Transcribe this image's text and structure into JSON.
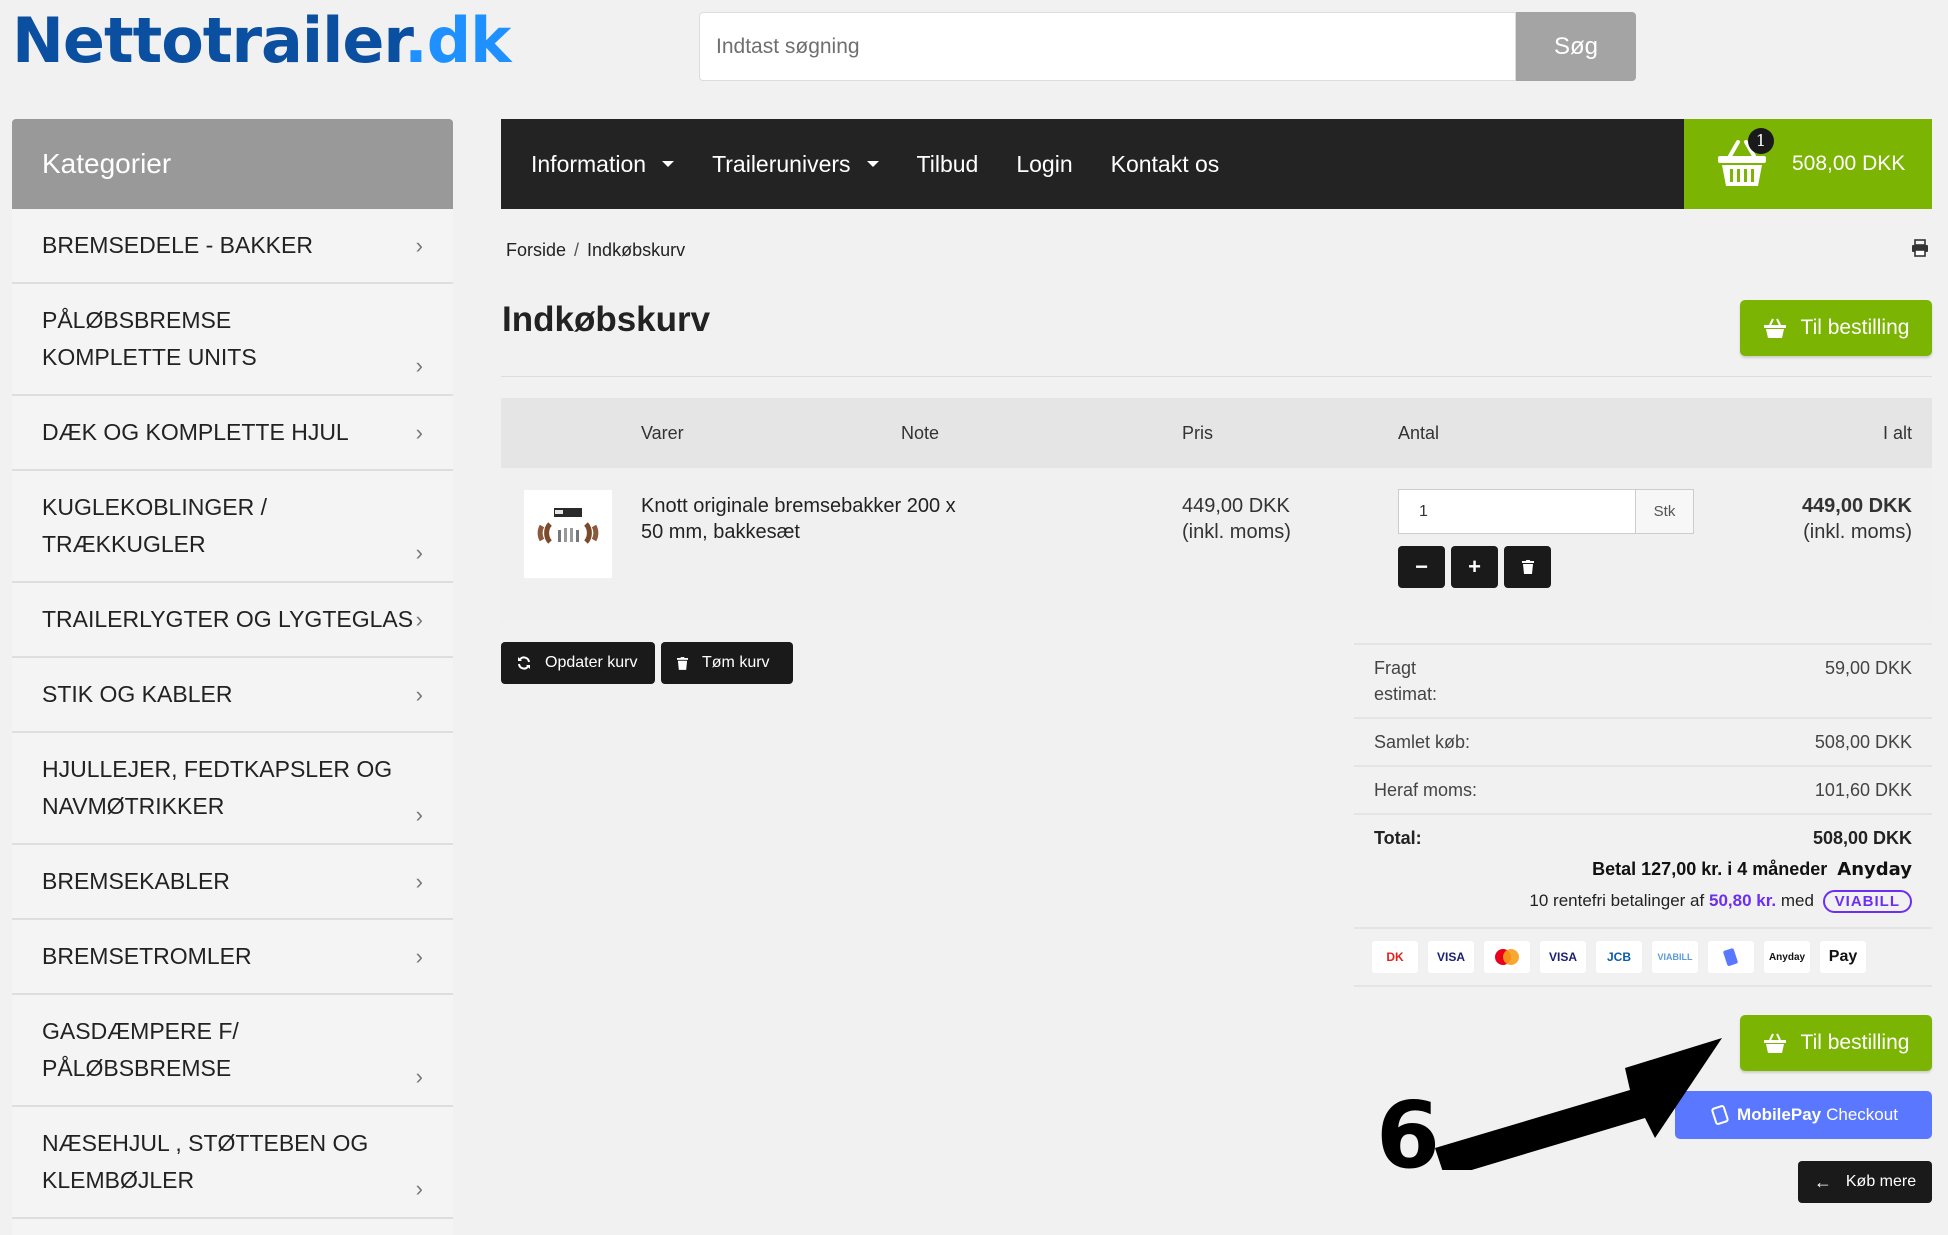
{
  "logo": {
    "main": "Nettotrailer",
    "tld": ".dk"
  },
  "search": {
    "placeholder": "Indtast søgning",
    "button": "Søg"
  },
  "sidebar": {
    "title": "Kategorier",
    "items": [
      {
        "label": "BREMSEDELE - BAKKER"
      },
      {
        "label": "PÅLØBSBREMSE KOMPLETTE UNITS"
      },
      {
        "label": "DÆK OG KOMPLETTE HJUL"
      },
      {
        "label": "KUGLEKOBLINGER / TRÆKKUGLER"
      },
      {
        "label": "TRAILERLYGTER OG LYGTEGLAS"
      },
      {
        "label": "STIK OG KABLER"
      },
      {
        "label": "HJULLEJER, FEDTKAPSLER OG NAVMØTRIKKER"
      },
      {
        "label": "BREMSEKABLER"
      },
      {
        "label": "BREMSETROMLER"
      },
      {
        "label": "GASDÆMPERE F/ PÅLØBSBREMSE"
      },
      {
        "label": "NÆSEHJUL , STØTTEBEN OG KLEMBØJLER"
      }
    ]
  },
  "nav": {
    "items": [
      {
        "label": "Information"
      },
      {
        "label": "Trailerunivers"
      },
      {
        "label": "Tilbud"
      },
      {
        "label": "Login"
      },
      {
        "label": "Kontakt os"
      }
    ]
  },
  "cart_widget": {
    "count": "1",
    "total": "508,00 DKK"
  },
  "breadcrumb": {
    "home": "Forside",
    "sep": "/",
    "current": "Indkøbskurv"
  },
  "page": {
    "title": "Indkøbskurv",
    "checkout_label": "Til bestilling"
  },
  "table": {
    "headers": {
      "items": "Varer",
      "note": "Note",
      "price": "Pris",
      "qty": "Antal",
      "total": "I alt"
    },
    "rows": [
      {
        "name": "Knott originale bremsebakker 200 x 50 mm, bakkesæt",
        "price": "449,00 DKK",
        "price_note": "(inkl. moms)",
        "qty": "1",
        "unit": "Stk",
        "line_total": "449,00 DKK",
        "line_total_note": "(inkl. moms)"
      }
    ]
  },
  "actions": {
    "update": "Opdater kurv",
    "empty": "Tøm kurv"
  },
  "summary": {
    "freight_label": "Fragt estimat:",
    "freight_value": "59,00 DKK",
    "subtotal_label": "Samlet køb:",
    "subtotal_value": "508,00 DKK",
    "vat_label": "Heraf moms:",
    "vat_value": "101,60 DKK",
    "total_label": "Total:",
    "total_value": "508,00 DKK",
    "anyday_text": "Betal 127,00 kr. i 4 måneder",
    "anyday_brand": "Anyday",
    "viabill_prefix": "10 rentefri betalinger af",
    "viabill_amount": "50,80 kr.",
    "viabill_mid": "med",
    "viabill_brand": "VIABILL"
  },
  "payment_icons": [
    {
      "icon": "dankort-icon",
      "text": "DK"
    },
    {
      "icon": "visa-electron-icon",
      "text": "VISA"
    },
    {
      "icon": "mastercard-icon",
      "text": ""
    },
    {
      "icon": "visa-icon",
      "text": "VISA"
    },
    {
      "icon": "jcb-icon",
      "text": "JCB"
    },
    {
      "icon": "viabill-icon",
      "text": "VIABILL"
    },
    {
      "icon": "mobilepay-icon",
      "text": ""
    },
    {
      "icon": "anyday-icon",
      "text": "Anyday"
    },
    {
      "icon": "applepay-icon",
      "text": "Pay"
    }
  ],
  "bottom": {
    "checkout_label": "Til bestilling",
    "mobilepay_brand": "MobilePay",
    "mobilepay_text": "Checkout",
    "buy_more": "Køb mere"
  },
  "annotation": {
    "number": "6"
  },
  "colors": {
    "brand_green": "#7cb404",
    "nav_dark": "#232323",
    "mobilepay_blue": "#5a78ff",
    "viabill_purple": "#6b2ef2",
    "logo_blue": "#0a4fa0"
  }
}
